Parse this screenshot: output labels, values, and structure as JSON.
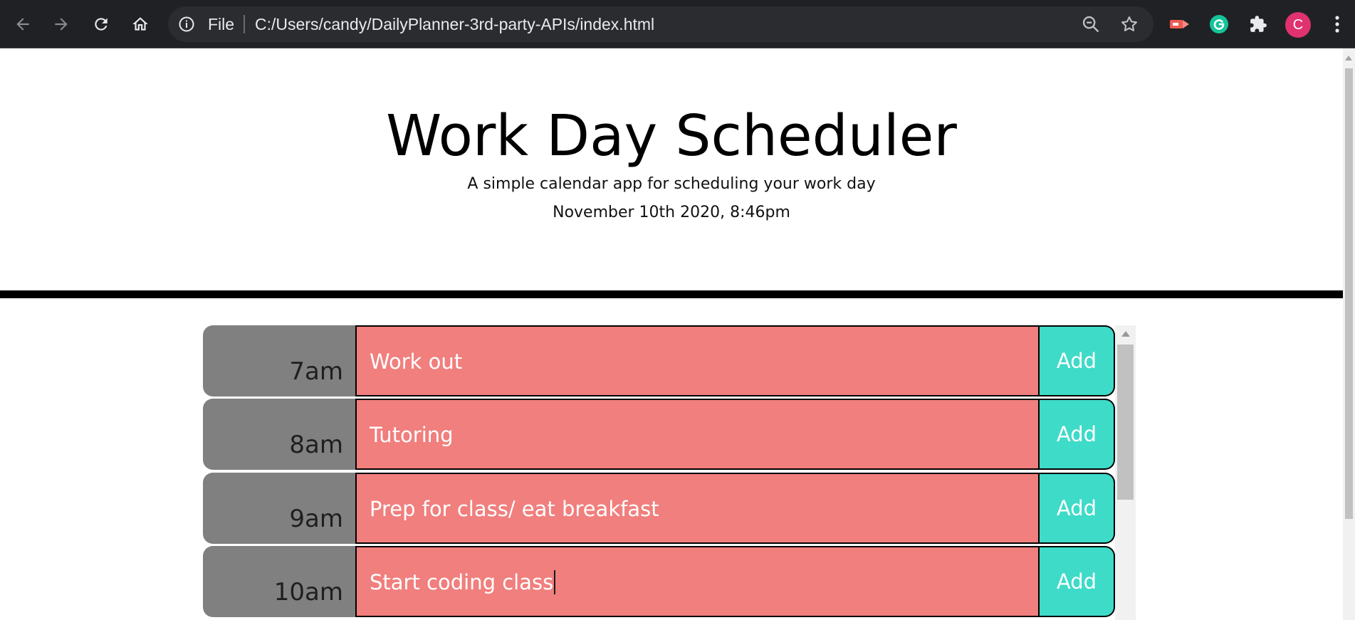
{
  "browser": {
    "scheme_label": "File",
    "url": "C:/Users/candy/DailyPlanner-3rd-party-APIs/index.html",
    "profile_initial": "C",
    "profile_color": "#e0326e",
    "toolbar_icons": [
      "back-icon",
      "forward-icon",
      "reload-icon",
      "home-icon",
      "info-icon",
      "zoom-out-icon",
      "star-icon",
      "screencast-extension-icon",
      "grammarly-extension-icon",
      "extensions-puzzle-icon",
      "menu-kebab-icon"
    ]
  },
  "header": {
    "title": "Work Day Scheduler",
    "subtitle": "A simple calendar app for scheduling your work day",
    "current_datetime": "November 10th 2020, 8:46pm"
  },
  "schedule": {
    "rows": [
      {
        "hour": "7am",
        "task": "Work out",
        "button": "Add"
      },
      {
        "hour": "8am",
        "task": "Tutoring",
        "button": "Add"
      },
      {
        "hour": "9am",
        "task": "Prep for class/ eat breakfast",
        "button": "Add"
      },
      {
        "hour": "10am",
        "task": "Start coding class",
        "button": "Add"
      }
    ]
  },
  "colors": {
    "past_task_bg": "#f07f7d",
    "hour_bg": "#808080",
    "save_button_bg": "#3ddbc8",
    "divider": "#000000"
  }
}
